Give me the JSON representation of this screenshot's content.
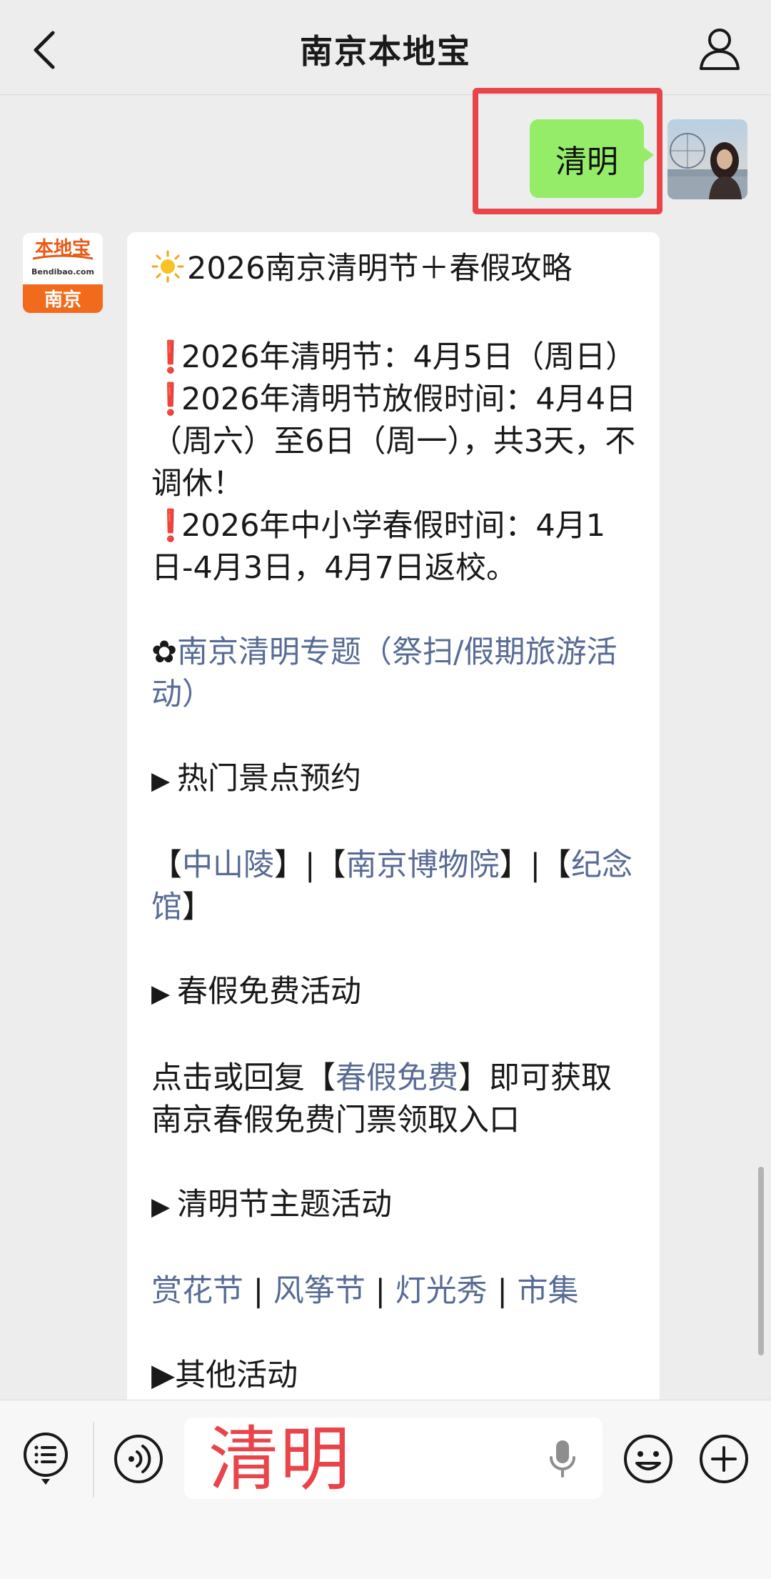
{
  "header": {
    "title": "南京本地宝"
  },
  "outgoing": {
    "text": "清明"
  },
  "incoming_avatar": {
    "top": "本地宝",
    "sub": "Bendibao.com",
    "city": "南京"
  },
  "message": {
    "heading": "2026南京清明节＋春假攻略",
    "item1": "2026年清明节：4月5日（周日）",
    "item2": "2026年清明节放假时间：4月4日（周六）至6日（周一），共3天，不调休！",
    "item3": "2026年中小学春假时间：4月1日-4月3日，4月7日返校。",
    "topic_mark": "✿",
    "topic_link": "南京清明专题（祭扫/假期旅游活动）",
    "section1": "热门景点预约",
    "spot1": "中山陵",
    "spot2": "南京博物院",
    "spot3": "纪念馆",
    "section2": "春假免费活动",
    "free_pre": "点击或回复【",
    "free_link": "春假免费",
    "free_post": "】即可获取南京春假免费门票领取入口",
    "section3": "清明节主题活动",
    "act1": "赏花节",
    "act2": "风筝节",
    "act3": "灯光秀",
    "act4": "市集",
    "section4_partial": "▶其他活动"
  },
  "input": {
    "text": "清明"
  },
  "colors": {
    "accent_green": "#95ec69",
    "link": "#576b95",
    "highlight_red": "#e8444a"
  }
}
